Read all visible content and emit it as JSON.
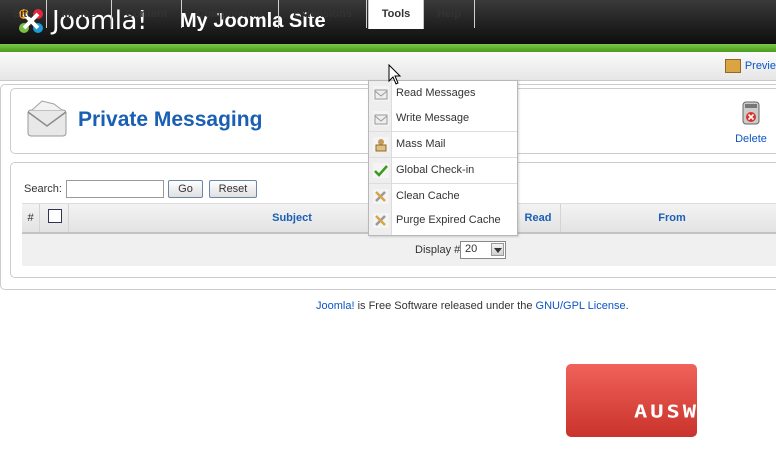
{
  "header": {
    "logo_text": "Joomla!",
    "site_title": "My Joomla Site",
    "brand_colors": {
      "green": "#5aaa24",
      "dark": "#1a1a1a"
    }
  },
  "menu": {
    "items": [
      {
        "label": "Site"
      },
      {
        "label": "Menus"
      },
      {
        "label": "Content"
      },
      {
        "label": "Components"
      },
      {
        "label": "Extensions"
      },
      {
        "label": "Tools"
      },
      {
        "label": "Help"
      }
    ],
    "preview_label": "Previe",
    "active": "Tools"
  },
  "tools_menu": {
    "items": [
      {
        "label": "Read Messages",
        "icon": "envelope-icon"
      },
      {
        "label": "Write Message",
        "icon": "envelope-write-icon"
      },
      {
        "label": "Mass Mail",
        "icon": "mass-mail-icon"
      },
      {
        "label": "Global Check-in",
        "icon": "checkmark-icon"
      },
      {
        "label": "Clean Cache",
        "icon": "tools-icon"
      },
      {
        "label": "Purge Expired Cache",
        "icon": "tools-icon"
      }
    ]
  },
  "page": {
    "title": "Private Messaging",
    "delete_label": "Delete"
  },
  "filter": {
    "search_label": "Search:",
    "search_value": "",
    "go_label": "Go",
    "reset_label": "Reset"
  },
  "table": {
    "columns": [
      "#",
      "",
      "Subject",
      "Read",
      "From"
    ],
    "display_label": "Display #",
    "display_value": "20"
  },
  "footer": {
    "link1": "Joomla!",
    "middle": " is Free Software released under the ",
    "link2": "GNU/GPL License",
    "end": "."
  },
  "watermark": {
    "text": "AUSWEB"
  }
}
